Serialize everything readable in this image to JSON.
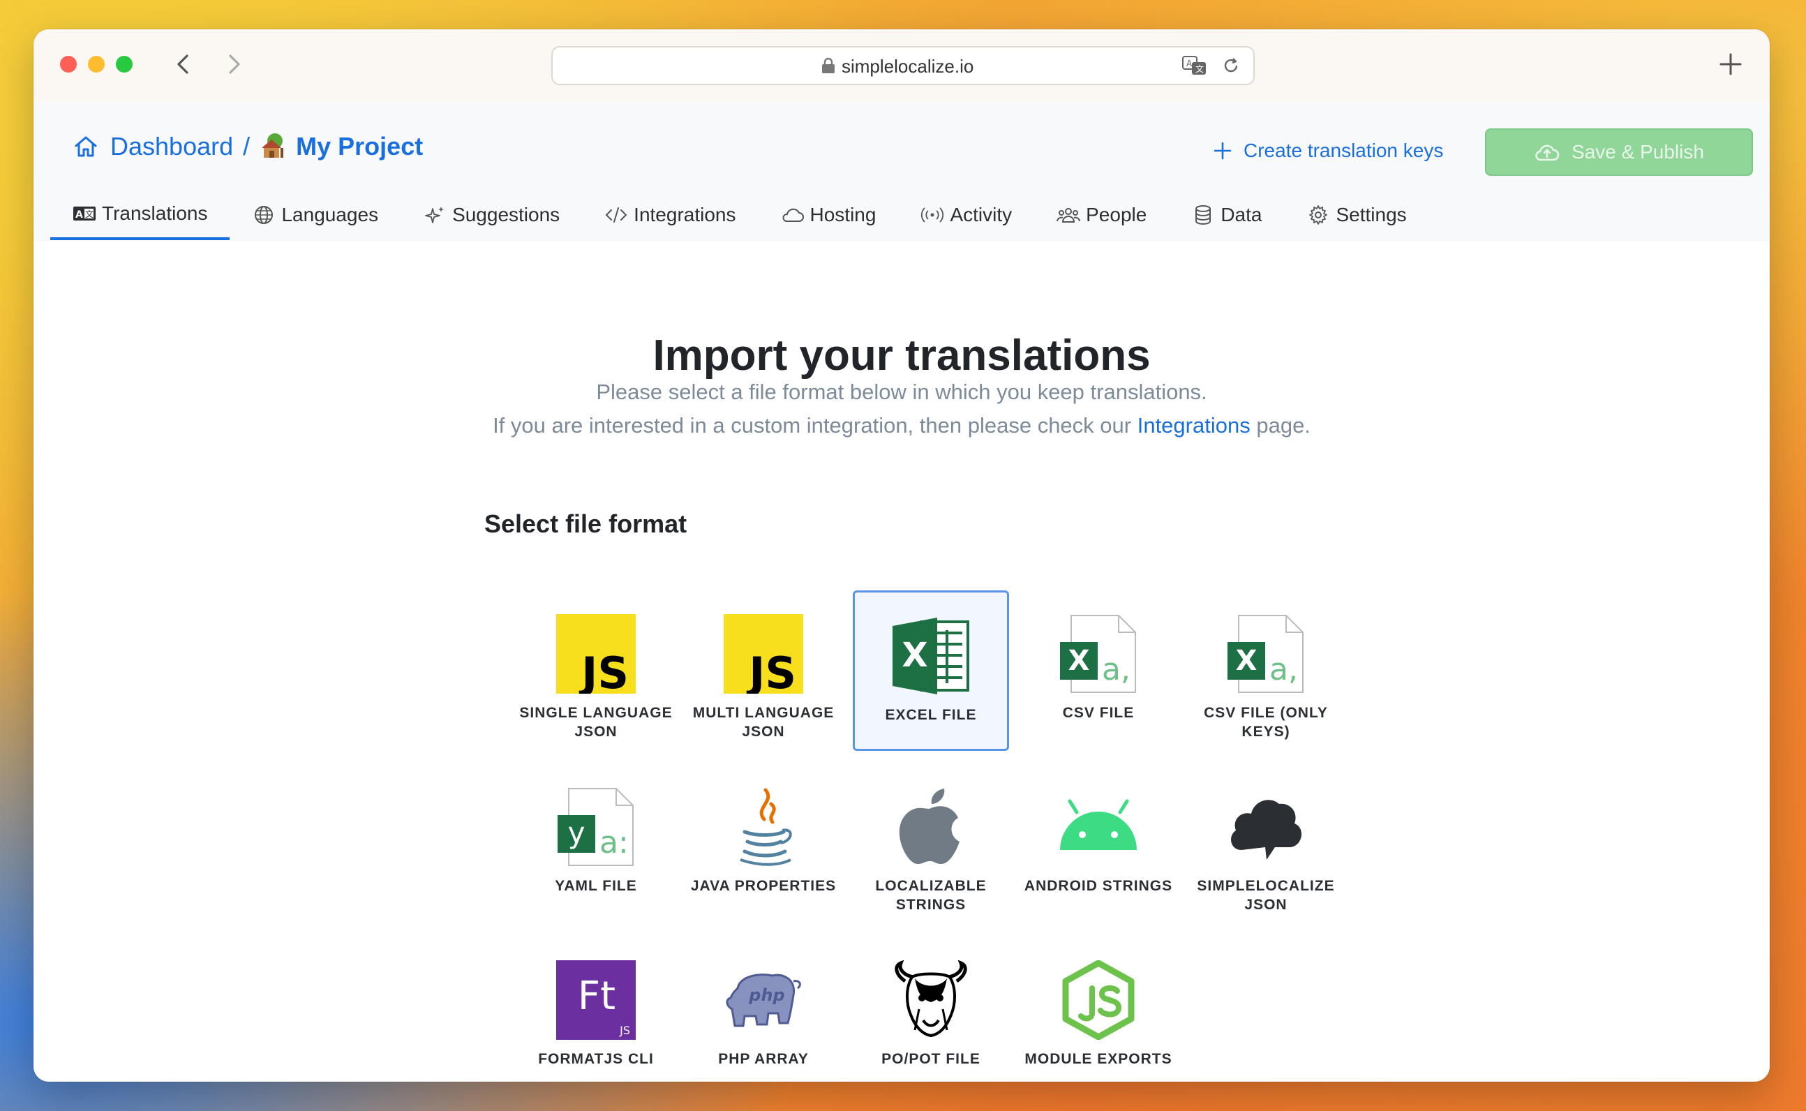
{
  "browser": {
    "url": "simplelocalize.io"
  },
  "header": {
    "breadcrumb_home": "Dashboard",
    "breadcrumb_separator": "/",
    "project_name": "My Project",
    "create_keys_label": "Create translation keys",
    "publish_label": "Save & Publish"
  },
  "tabs": [
    {
      "label": "Translations",
      "icon": "translations-icon",
      "active": true
    },
    {
      "label": "Languages",
      "icon": "globe-icon"
    },
    {
      "label": "Suggestions",
      "icon": "sparkle-icon"
    },
    {
      "label": "Integrations",
      "icon": "code-icon"
    },
    {
      "label": "Hosting",
      "icon": "cloud-icon"
    },
    {
      "label": "Activity",
      "icon": "broadcast-icon"
    },
    {
      "label": "People",
      "icon": "people-icon"
    },
    {
      "label": "Data",
      "icon": "database-icon"
    },
    {
      "label": "Settings",
      "icon": "gear-icon"
    }
  ],
  "main": {
    "title": "Import your translations",
    "subtitle_line1": "Please select a file format below in which you keep translations.",
    "subtitle_line2_prefix": "If you are interested in a custom integration, then please check our",
    "subtitle_line2_link": "Integrations",
    "subtitle_line2_suffix": "page.",
    "section_title": "Select file format"
  },
  "formats": [
    {
      "label": "Single language JSON",
      "icon": "js-icon",
      "selected": false
    },
    {
      "label": "Multi language JSON",
      "icon": "js-icon",
      "selected": false
    },
    {
      "label": "Excel file",
      "icon": "excel-icon",
      "selected": true
    },
    {
      "label": "CSV file",
      "icon": "csv-icon",
      "selected": false
    },
    {
      "label": "CSV file (only keys)",
      "icon": "csv-icon",
      "selected": false
    },
    {
      "label": "YAML file",
      "icon": "yaml-icon",
      "selected": false
    },
    {
      "label": "Java properties",
      "icon": "java-icon",
      "selected": false
    },
    {
      "label": "Localizable strings",
      "icon": "apple-icon",
      "selected": false
    },
    {
      "label": "Android strings",
      "icon": "android-icon",
      "selected": false
    },
    {
      "label": "SimpleLocalize JSON",
      "icon": "simplelocalize-cloud-icon",
      "selected": false
    },
    {
      "label": "FormatJS CLI",
      "icon": "formatjs-icon",
      "selected": false
    },
    {
      "label": "PHP array",
      "icon": "php-icon",
      "selected": false
    },
    {
      "label": "PO/POT file",
      "icon": "gnu-icon",
      "selected": false
    },
    {
      "label": "Module exports",
      "icon": "nodejs-icon",
      "selected": false
    }
  ],
  "icon_texts": {
    "js": "JS",
    "excel": "X",
    "csv": "X",
    "csv_sample": "a,",
    "yaml": "y",
    "yaml_sample": "a:",
    "formatjs": "Ft",
    "formatjs_sub": "JS",
    "php": "php"
  },
  "colors": {
    "accent": "#1a6fe0",
    "publish_button": "#8fd698",
    "selected_tile": "#f1f6ff"
  }
}
